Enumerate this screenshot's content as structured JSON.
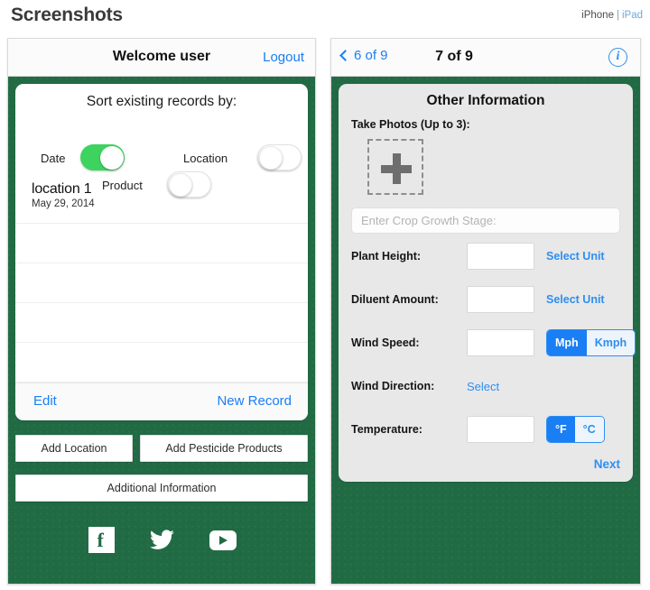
{
  "header": {
    "site_title": "Screenshots",
    "device_links": {
      "iphone": "iPhone",
      "separator": "|",
      "ipad": "iPad"
    }
  },
  "colors": {
    "green_background": "#216b44",
    "ios_blue": "#1a7ef5",
    "toggle_on_green": "#3ed35f",
    "grey_card": "#e8e8e8",
    "page_background": "#ffffff"
  },
  "left_phone": {
    "navbar": {
      "title": "Welcome user",
      "logout_label": "Logout"
    },
    "sort_card": {
      "title": "Sort existing records by:",
      "toggles": [
        {
          "label": "Date",
          "state": "on"
        },
        {
          "label": "Location",
          "state": "off"
        },
        {
          "label": "Product",
          "state": "off"
        }
      ],
      "records": [
        {
          "name": "location 1",
          "date": "May 29, 2014"
        }
      ],
      "empty_rows": 4,
      "footer": {
        "edit_label": "Edit",
        "new_record_label": "New Record"
      }
    },
    "buttons": {
      "add_location": "Add Location",
      "add_pesticide_products": "Add Pesticide Products",
      "additional_information": "Additional Information"
    },
    "social": [
      {
        "name": "facebook-icon",
        "glyph": "f"
      },
      {
        "name": "twitter-icon",
        "glyph": "🐦"
      },
      {
        "name": "youtube-icon",
        "glyph": "▶"
      }
    ]
  },
  "right_phone": {
    "navbar": {
      "back_label": "6 of 9",
      "title": "7 of 9",
      "info_glyph": "i"
    },
    "form_card": {
      "title": "Other Information",
      "take_photos_label": "Take Photos (Up to 3):",
      "crop_stage_placeholder": "Enter Crop Growth Stage:",
      "crop_stage_value": "",
      "fields": [
        {
          "label": "Plant Height:",
          "value": "",
          "control": "link",
          "link_label": "Select Unit"
        },
        {
          "label": "Diluent Amount:",
          "value": "",
          "control": "link",
          "link_label": "Select Unit"
        },
        {
          "label": "Wind Speed:",
          "value": "",
          "control": "segmented",
          "options": [
            "Mph",
            "Kmph"
          ],
          "selected": "Mph"
        },
        {
          "label": "Wind Direction:",
          "control": "plain-link",
          "link_label": "Select"
        },
        {
          "label": "Temperature:",
          "value": "",
          "control": "segmented",
          "options": [
            "°F",
            "°C"
          ],
          "selected": "°F"
        }
      ],
      "next_label": "Next"
    }
  }
}
